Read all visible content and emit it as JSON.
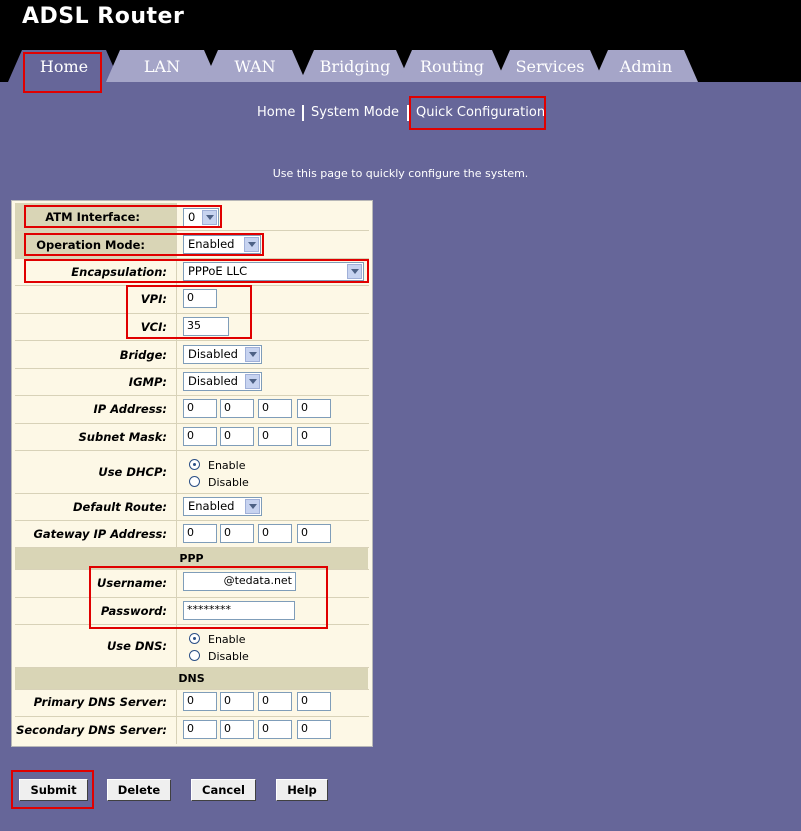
{
  "app": {
    "title": "ADSL Router"
  },
  "tabs": [
    "Home",
    "LAN",
    "WAN",
    "Bridging",
    "Routing",
    "Services",
    "Admin"
  ],
  "subnav": {
    "home": "Home",
    "system_mode": "System Mode",
    "quick_config": "Quick Configuration"
  },
  "description": "Use this page to quickly configure the system.",
  "form": {
    "atm_interface": {
      "label": "ATM Interface:",
      "value": "0"
    },
    "operation_mode": {
      "label": "Operation Mode:",
      "value": "Enabled"
    },
    "encapsulation": {
      "label": "Encapsulation:",
      "value": "PPPoE LLC"
    },
    "vpi": {
      "label": "VPI:",
      "value": "0"
    },
    "vci": {
      "label": "VCI:",
      "value": "35"
    },
    "bridge": {
      "label": "Bridge:",
      "value": "Disabled"
    },
    "igmp": {
      "label": "IGMP:",
      "value": "Disabled"
    },
    "ip_address": {
      "label": "IP Address:",
      "octets": [
        "0",
        "0",
        "0",
        "0"
      ]
    },
    "subnet_mask": {
      "label": "Subnet Mask:",
      "octets": [
        "0",
        "0",
        "0",
        "0"
      ]
    },
    "use_dhcp": {
      "label": "Use DHCP:",
      "enable": "Enable",
      "disable": "Disable",
      "selected": "Enable"
    },
    "default_route": {
      "label": "Default Route:",
      "value": "Enabled"
    },
    "gateway": {
      "label": "Gateway IP Address:",
      "octets": [
        "0",
        "0",
        "0",
        "0"
      ]
    },
    "ppp_header": "PPP",
    "username": {
      "label": "Username:",
      "value": "@tedata.net"
    },
    "password": {
      "label": "Password:",
      "value": "********"
    },
    "use_dns": {
      "label": "Use DNS:",
      "enable": "Enable",
      "disable": "Disable",
      "selected": "Enable"
    },
    "dns_header": "DNS",
    "primary_dns": {
      "label": "Primary DNS Server:",
      "octets": [
        "0",
        "0",
        "0",
        "0"
      ]
    },
    "secondary_dns": {
      "label": "Secondary DNS Server:",
      "octets": [
        "0",
        "0",
        "0",
        "0"
      ]
    }
  },
  "buttons": {
    "submit": "Submit",
    "delete": "Delete",
    "cancel": "Cancel",
    "help": "Help"
  },
  "colors": {
    "background": "#666699",
    "header": "#000000",
    "tab": "#a5a5c8",
    "panel": "#fdf8e6",
    "highlight": "#e00000"
  }
}
